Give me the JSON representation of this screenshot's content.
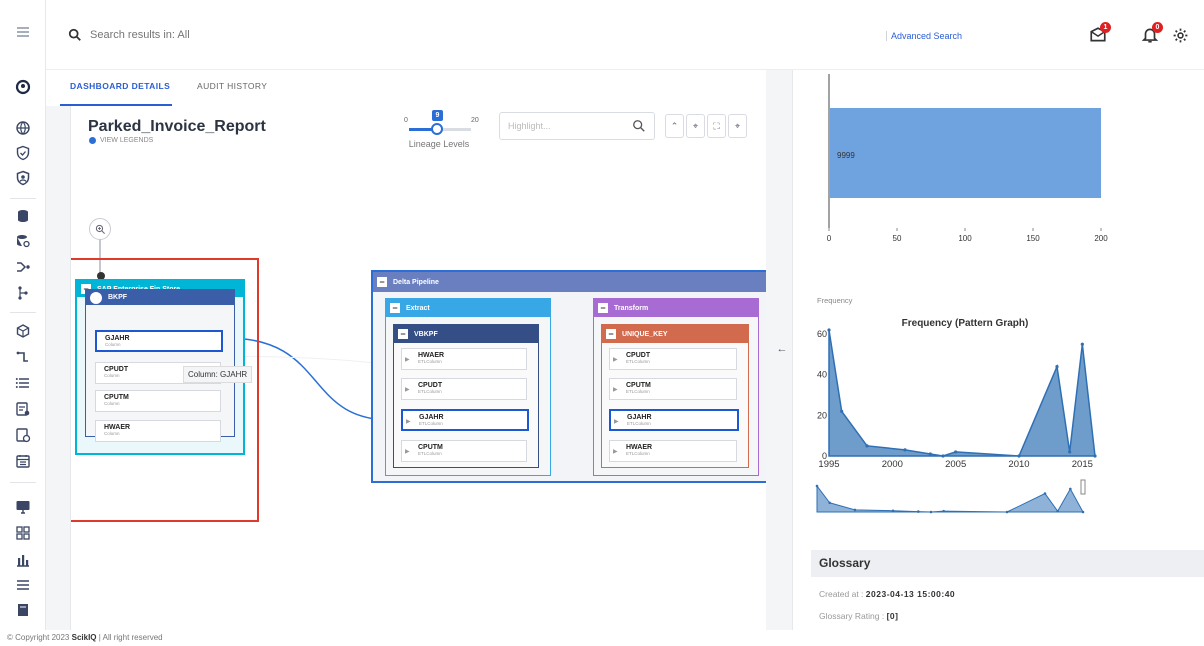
{
  "topbar": {
    "search_placeholder": "Search results in: All",
    "advanced_search": "Advanced Search",
    "notif_badge_1": "1",
    "notif_badge_2": "0"
  },
  "tabs": [
    {
      "label": "DASHBOARD DETAILS",
      "active": true
    },
    {
      "label": "AUDIT HISTORY",
      "active": false
    }
  ],
  "report": {
    "title": "Parked_Invoice_Report",
    "legends_link": "VIEW LEGENDS"
  },
  "lineage": {
    "min": "0",
    "max": "20",
    "value": "9",
    "label": "Lineage Levels",
    "highlight_placeholder": "Highlight..."
  },
  "nodes": {
    "sap_group": "SAP Enterprise Fin Store",
    "sap_table": "BKPF",
    "sap_columns": [
      {
        "name": "GJAHR",
        "type": "Column"
      },
      {
        "name": "CPUDT",
        "type": "Column"
      },
      {
        "name": "CPUTM",
        "type": "Column"
      },
      {
        "name": "HWAER",
        "type": "Column"
      }
    ],
    "tooltip": "Column: GJAHR",
    "pipeline": "Delta Pipeline",
    "extract": "Extract",
    "transform": "Transform",
    "vbkpf": "VBKPF",
    "vbkpf_columns": [
      {
        "name": "HWAER",
        "type": "ETLColumn"
      },
      {
        "name": "CPUDT",
        "type": "ETLColumn"
      },
      {
        "name": "GJAHR",
        "type": "ETLColumn"
      },
      {
        "name": "CPUTM",
        "type": "ETLColumn"
      }
    ],
    "unique_key": "UNIQUE_KEY",
    "unique_columns": [
      {
        "name": "CPUDT",
        "type": "ETLColumn"
      },
      {
        "name": "CPUTM",
        "type": "ETLColumn"
      },
      {
        "name": "GJAHR",
        "type": "ETLColumn"
      },
      {
        "name": "HWAER",
        "type": "ETLColumn"
      }
    ]
  },
  "chart_data": [
    {
      "type": "bar",
      "orientation": "horizontal",
      "categories": [
        ""
      ],
      "values": [
        200
      ],
      "data_label": "9999",
      "xlim": [
        0,
        200
      ],
      "xticks": [
        "0",
        "50",
        "100",
        "150",
        "200"
      ],
      "bar_color": "#6fa3e0"
    },
    {
      "type": "area",
      "title": "Frequency (Pattern Graph)",
      "ylabel": "Frequency",
      "x": [
        1995,
        1996,
        1998,
        2001,
        2003,
        2004,
        2005,
        2010,
        2013,
        2014,
        2015,
        2016
      ],
      "y": [
        62,
        22,
        5,
        3,
        1,
        0,
        2,
        0,
        44,
        2,
        55,
        0
      ],
      "xticks": [
        "1995",
        "2000",
        "2005",
        "2010",
        "2015"
      ],
      "yticks": [
        "0",
        "20",
        "40",
        "60"
      ],
      "ylim": [
        0,
        62
      ],
      "color": "#2f6fb3"
    }
  ],
  "glossary": {
    "heading": "Glossary",
    "created_label": "Created at :",
    "created_value": "2023-04-13 15:00:40",
    "rating_label": "Glossary Rating :",
    "rating_value": "[0]"
  },
  "footer": {
    "prefix": "© Copyright 2023",
    "brand": "ScikIQ",
    "suffix": "| All right reserved"
  }
}
